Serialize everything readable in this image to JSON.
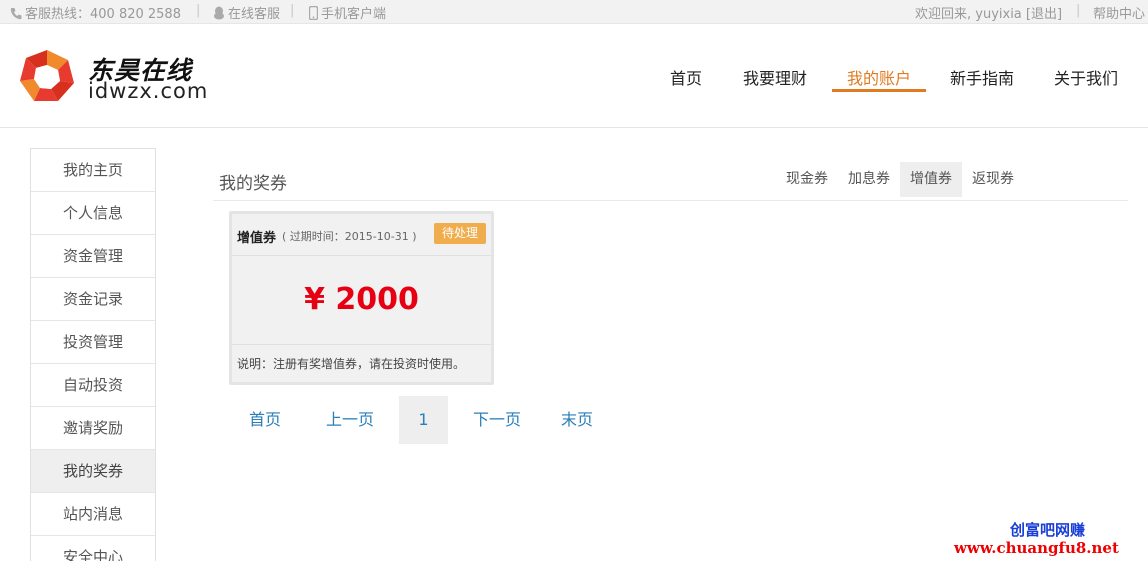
{
  "topbar": {
    "hotline": "客服热线：400 820 2588",
    "online_service": "在线客服",
    "mobile_client": "手机客户端",
    "welcome": "欢迎回来, yuyixia [退出]",
    "help": "帮助中心",
    "separator": "|"
  },
  "brand": {
    "name_cn": "东昊在线",
    "name_en": "idwzx.com",
    "colors": {
      "logo_red": "#e63b2e",
      "logo_orange": "#f08a2c"
    }
  },
  "nav": {
    "items": [
      {
        "label": "首页"
      },
      {
        "label": "我要理财"
      },
      {
        "label": "我的账户",
        "active": true
      },
      {
        "label": "新手指南"
      },
      {
        "label": "关于我们"
      }
    ],
    "active_color": "#e07b21"
  },
  "sidebar": {
    "items": [
      {
        "label": "我的主页"
      },
      {
        "label": "个人信息"
      },
      {
        "label": "资金管理"
      },
      {
        "label": "资金记录"
      },
      {
        "label": "投资管理"
      },
      {
        "label": "自动投资"
      },
      {
        "label": "邀请奖励"
      },
      {
        "label": "我的奖券",
        "active": true
      },
      {
        "label": "站内消息"
      },
      {
        "label": "安全中心"
      }
    ]
  },
  "main": {
    "title": "我的奖券",
    "tabs": [
      {
        "label": "现金券"
      },
      {
        "label": "加息券"
      },
      {
        "label": "增值券",
        "active": true
      },
      {
        "label": "返现券"
      }
    ]
  },
  "coupon": {
    "type": "增值券",
    "expiry": "( 过期时间：2015-10-31 )",
    "status": "待处理",
    "amount": "¥ 2000",
    "description": "说明：注册有奖增值券，请在投资时使用。",
    "colors": {
      "amount": "#e60012",
      "badge": "#f0ad4e"
    }
  },
  "pager": {
    "first": "首页",
    "prev": "上一页",
    "current": "1",
    "next": "下一页",
    "last": "末页"
  },
  "watermark": {
    "line1": "创富吧网赚",
    "line2": "www.chuangfu8.net"
  }
}
